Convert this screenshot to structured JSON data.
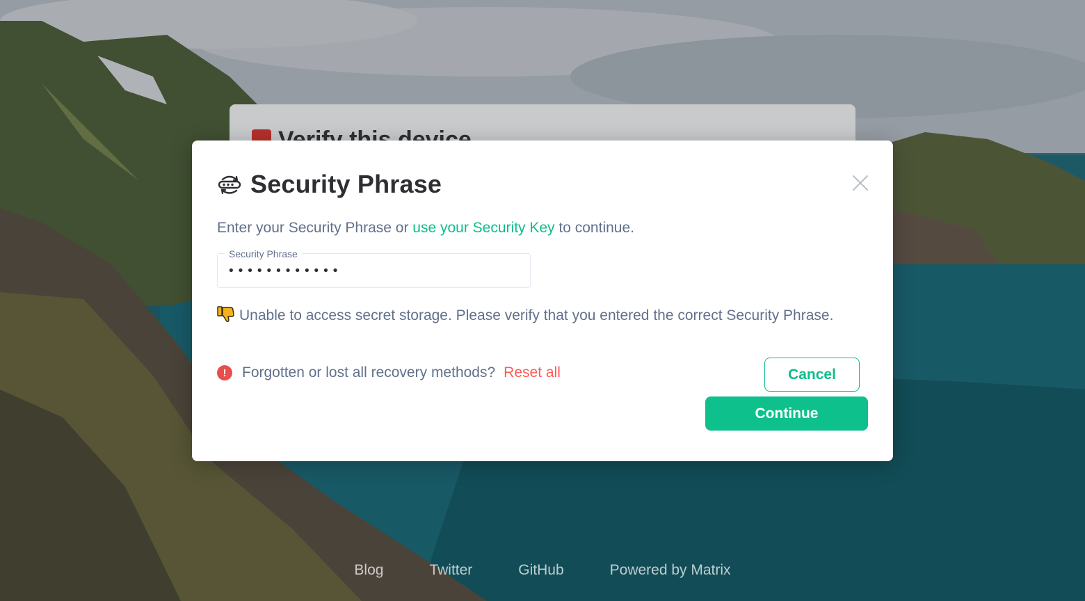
{
  "background": {
    "underlying_title": "Verify this device"
  },
  "dialog": {
    "title": "Security Phrase",
    "close_label": "×",
    "intro_prefix": "Enter your Security Phrase or ",
    "intro_link": "use your Security Key",
    "intro_suffix": " to continue.",
    "field": {
      "label": "Security Phrase",
      "value": "••••••••••••"
    },
    "error": "Unable to access secret storage. Please verify that you entered the correct Security Phrase.",
    "reset_prompt": "Forgotten or lost all recovery methods?",
    "reset_link": "Reset all",
    "cancel_label": "Cancel",
    "continue_label": "Continue"
  },
  "footer": {
    "links": [
      "Blog",
      "Twitter",
      "GitHub",
      "Powered by Matrix"
    ]
  },
  "colors": {
    "accent": "#0dbd8b",
    "danger": "#ff5b55",
    "text_primary": "#2e2f32",
    "text_secondary": "#61708b"
  }
}
